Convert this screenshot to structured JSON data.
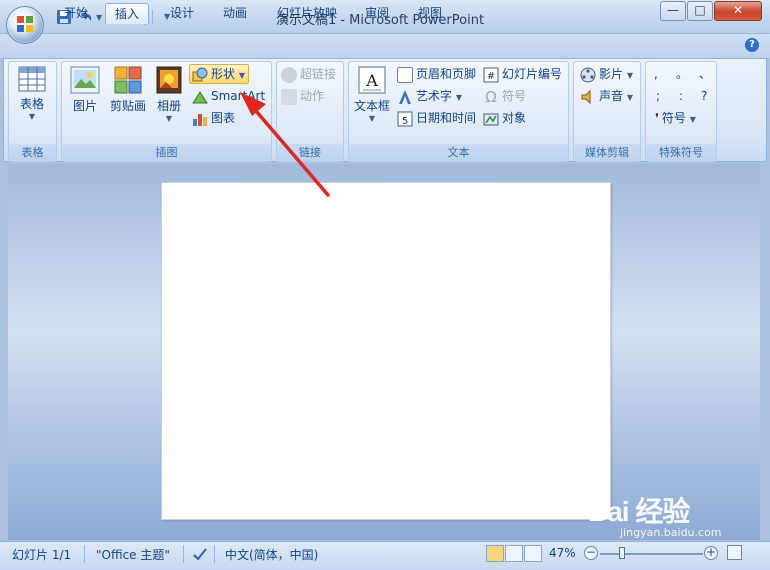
{
  "window": {
    "title": "演示文稿1 - Microsoft PowerPoint",
    "min": "—",
    "max": "□",
    "close": "✕"
  },
  "tabs": [
    {
      "label": "开始"
    },
    {
      "label": "插入"
    },
    {
      "label": "设计"
    },
    {
      "label": "动画"
    },
    {
      "label": "幻灯片放映"
    },
    {
      "label": "审阅"
    },
    {
      "label": "视图"
    }
  ],
  "ribbon": {
    "tables": {
      "group": "表格",
      "table": "表格"
    },
    "illustrations": {
      "group": "插图",
      "picture": "图片",
      "clipart": "剪贴画",
      "album": "相册",
      "shapes": "形状",
      "smartart": "SmartArt",
      "chart": "图表"
    },
    "links": {
      "group": "链接",
      "hyperlink": "超链接",
      "action": "动作"
    },
    "text": {
      "group": "文本",
      "textbox": "文本框",
      "header_footer": "页眉和页脚",
      "wordart": "艺术字",
      "datetime": "日期和时间",
      "slide_number": "幻灯片编号",
      "symbol": "符号",
      "object": "对象"
    },
    "media": {
      "group": "媒体剪辑",
      "movie": "影片",
      "sound": "声音"
    },
    "special": {
      "group": "特殊符号",
      "symbol": "符号",
      "chars": [
        ",",
        "。",
        "、",
        ";",
        ":",
        "?"
      ]
    }
  },
  "status": {
    "slide": "幻灯片 1/1",
    "theme": "\"Office 主题\"",
    "language": "中文(简体，中国)",
    "zoom": "47%"
  },
  "watermark": {
    "brand": "Bai 经验",
    "url": "jingyan.baidu.com"
  },
  "colors": {
    "accent": "#15428b",
    "arrow": "#e0261f"
  }
}
